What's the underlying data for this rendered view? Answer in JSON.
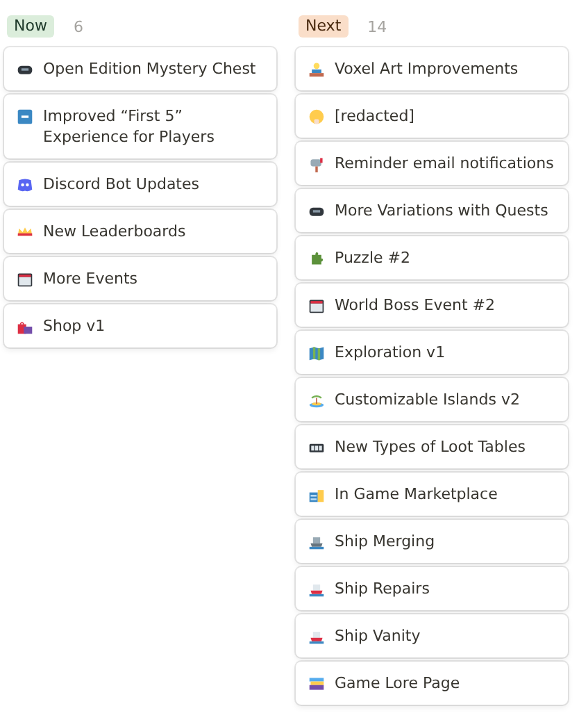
{
  "columns": [
    {
      "label": "Now",
      "color": "#dbeddb",
      "count": "6",
      "cards": [
        {
          "title": "Open Edition Mystery Chest"
        },
        {
          "title": "Improved “First 5” Experience for Players"
        },
        {
          "title": "Discord Bot Updates"
        },
        {
          "title": "New Leaderboards"
        },
        {
          "title": "More Events"
        },
        {
          "title": "Shop v1"
        }
      ]
    },
    {
      "label": "Next",
      "color": "#fadec9",
      "count": "14",
      "cards": [
        {
          "title": "Voxel Art Improvements"
        },
        {
          "title": "[redacted]"
        },
        {
          "title": "Reminder email notifications"
        },
        {
          "title": "More Variations with Quests"
        },
        {
          "title": "Puzzle #2"
        },
        {
          "title": "World Boss Event #2"
        },
        {
          "title": "Exploration v1"
        },
        {
          "title": "Customizable Islands v2"
        },
        {
          "title": "New Types of Loot Tables"
        },
        {
          "title": "In Game Marketplace"
        },
        {
          "title": "Ship Merging"
        },
        {
          "title": "Ship Repairs"
        },
        {
          "title": "Ship Vanity"
        },
        {
          "title": "Game Lore Page"
        }
      ]
    }
  ]
}
